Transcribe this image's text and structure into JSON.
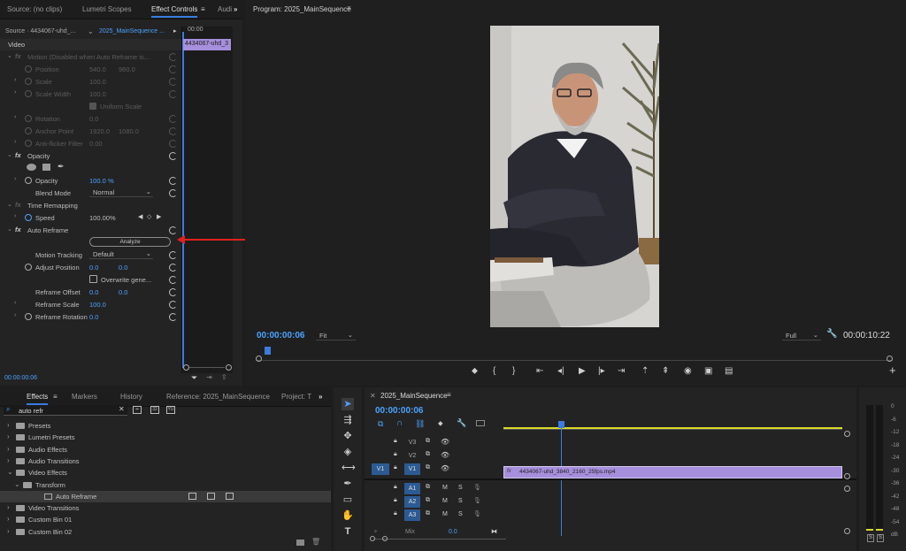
{
  "source_panel": {
    "tabs": [
      "Source: (no clips)",
      "Lumetri Scopes",
      "Effect Controls",
      "Audi"
    ],
    "source_label": "Source · 4434067-uhd_...",
    "sequence_label": "2025_MainSequence ...",
    "timecode_ruler": "00:00",
    "clip_label": "4434067-uhd_3",
    "section_video": "Video",
    "motion_label": "Motion (Disabled when Auto Reframe is...",
    "position": {
      "label": "Position",
      "v1": "540.0",
      "v2": "960.0"
    },
    "scale": {
      "label": "Scale",
      "v": "100.0"
    },
    "scale_width": {
      "label": "Scale Width",
      "v": "100.0"
    },
    "uniform_scale": "Uniform Scale",
    "rotation": {
      "label": "Rotation",
      "v": "0.0"
    },
    "anchor_point": {
      "label": "Anchor Point",
      "v1": "1920.0",
      "v2": "1080.0"
    },
    "anti_flicker": {
      "label": "Anti-flicker Filter",
      "v": "0.00"
    },
    "opacity_section": "Opacity",
    "opacity": {
      "label": "Opacity",
      "v": "100.0",
      "unit": "%"
    },
    "blend_mode": {
      "label": "Blend Mode",
      "v": "Normal"
    },
    "time_remapping": "Time Remapping",
    "speed": {
      "label": "Speed",
      "v": "100.00%"
    },
    "auto_reframe": "Auto Reframe",
    "analyze_button": "Analyze",
    "motion_tracking": {
      "label": "Motion Tracking",
      "v": "Default"
    },
    "adjust_position": {
      "label": "Adjust Position",
      "v1": "0.0",
      "v2": "0.0"
    },
    "overwrite": "Overwrite gene...",
    "reframe_offset": {
      "label": "Reframe Offset",
      "v1": "0.0",
      "v2": "0.0"
    },
    "reframe_scale": {
      "label": "Reframe Scale",
      "v": "100.0"
    },
    "reframe_rotation": {
      "label": "Reframe Rotation",
      "v": "0.0"
    },
    "bottom_timecode": "00:00:00:06",
    "fx": "fx"
  },
  "program_panel": {
    "title": "Program: 2025_MainSequence",
    "timecode": "00:00:00:06",
    "fit": "Fit",
    "quality": "Full",
    "duration": "00:00:10:22"
  },
  "effects_panel": {
    "tabs": [
      "Effects",
      "Markers",
      "History",
      "Reference: 2025_MainSequence",
      "Project: T"
    ],
    "search_value": "auto refr",
    "tree": [
      {
        "label": "Presets",
        "indent": 0,
        "type": "preset"
      },
      {
        "label": "Lumetri Presets",
        "indent": 0,
        "type": "preset"
      },
      {
        "label": "Audio Effects",
        "indent": 0,
        "type": "folder"
      },
      {
        "label": "Audio Transitions",
        "indent": 0,
        "type": "folder"
      },
      {
        "label": "Video Effects",
        "indent": 0,
        "type": "folder",
        "open": true
      },
      {
        "label": "Transform",
        "indent": 1,
        "type": "folder",
        "open": true
      },
      {
        "label": "Auto Reframe",
        "indent": 2,
        "type": "effect",
        "selected": true
      },
      {
        "label": "Video Transitions",
        "indent": 0,
        "type": "folder"
      },
      {
        "label": "Custom Bin 01",
        "indent": 0,
        "type": "folder"
      },
      {
        "label": "Custom Bin 02",
        "indent": 0,
        "type": "folder"
      }
    ]
  },
  "timeline_panel": {
    "title": "2025_MainSequence",
    "timecode": "00:00:00:06",
    "video_tracks": [
      "V3",
      "V2",
      "V1"
    ],
    "source_patch_video": "V1",
    "audio_tracks": [
      "A1",
      "A2",
      "A3"
    ],
    "mix_label": "Mix",
    "mix_value": "0.0",
    "clip_name": "4434067-uhd_3840_2160_25fps.mp4",
    "track_m": "M",
    "track_s": "S"
  },
  "audio_meter": {
    "scale": [
      "0",
      "-6",
      "-12",
      "-18",
      "-24",
      "-30",
      "-36",
      "-42",
      "-48",
      "-54",
      "dB"
    ],
    "solo": [
      "S",
      "S"
    ]
  },
  "colors": {
    "accent": "#3a7ce0",
    "timecode": "#4aa3ff",
    "clip": "#a68fdc",
    "arrow": "#e02020",
    "playhead": "#3a7ce0"
  }
}
